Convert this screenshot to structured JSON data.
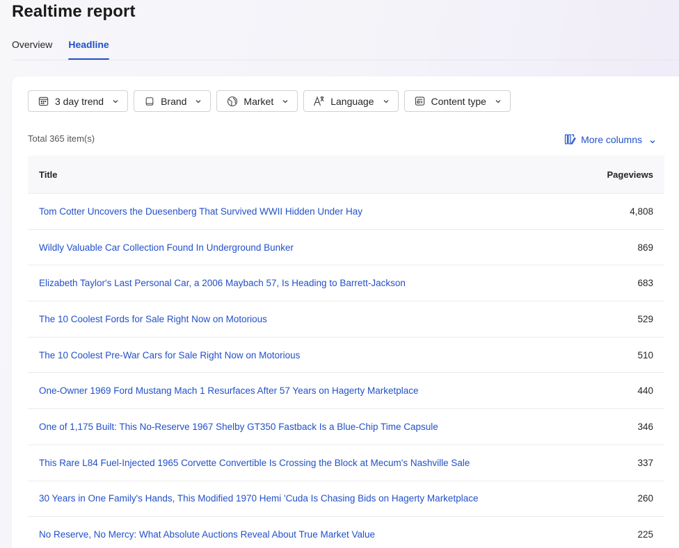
{
  "header": {
    "title": "Realtime report"
  },
  "tabs": [
    {
      "label": "Overview",
      "active": false
    },
    {
      "label": "Headline",
      "active": true
    }
  ],
  "filters": [
    {
      "label": "3 day trend",
      "icon": "calendar-icon"
    },
    {
      "label": "Brand",
      "icon": "square-icon"
    },
    {
      "label": "Market",
      "icon": "globe-icon"
    },
    {
      "label": "Language",
      "icon": "translate-icon"
    },
    {
      "label": "Content type",
      "icon": "document-icon"
    }
  ],
  "summary": {
    "total": "Total 365 item(s)",
    "more_columns": "More columns"
  },
  "table": {
    "columns": {
      "title": "Title",
      "pageviews": "Pageviews"
    },
    "rows": [
      {
        "title": "Tom Cotter Uncovers the Duesenberg That Survived WWII Hidden Under Hay",
        "pageviews": "4,808"
      },
      {
        "title": "Wildly Valuable Car Collection Found In Underground Bunker",
        "pageviews": "869"
      },
      {
        "title": "Elizabeth Taylor's Last Personal Car, a 2006 Maybach 57, Is Heading to Barrett-Jackson",
        "pageviews": "683"
      },
      {
        "title": "The 10 Coolest Fords for Sale Right Now on Motorious",
        "pageviews": "529"
      },
      {
        "title": "The 10 Coolest Pre-War Cars for Sale Right Now on Motorious",
        "pageviews": "510"
      },
      {
        "title": "One-Owner 1969 Ford Mustang Mach 1 Resurfaces After 57 Years on Hagerty Marketplace",
        "pageviews": "440"
      },
      {
        "title": "One of 1,175 Built: This No-Reserve 1967 Shelby GT350 Fastback Is a Blue-Chip Time Capsule",
        "pageviews": "346"
      },
      {
        "title": "This Rare L84 Fuel-Injected 1965 Corvette Convertible Is Crossing the Block at Mecum's Nashville Sale",
        "pageviews": "337"
      },
      {
        "title": "30 Years in One Family's Hands, This Modified 1970 Hemi 'Cuda Is Chasing Bids on Hagerty Marketplace",
        "pageviews": "260"
      },
      {
        "title": "No Reserve, No Mercy: What Absolute Auctions Reveal About True Market Value",
        "pageviews": "225"
      }
    ]
  },
  "colors": {
    "accent": "#2150c9",
    "text": "#242424",
    "border": "#d1d1d1"
  }
}
